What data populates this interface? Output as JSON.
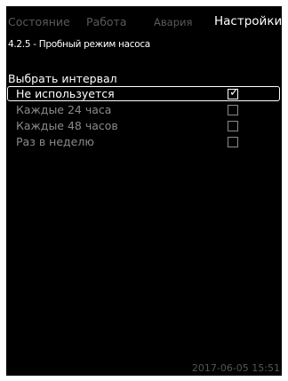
{
  "tabs": [
    {
      "label": "Состояние",
      "active": false
    },
    {
      "label": "Работа",
      "active": false
    },
    {
      "label": "Авария",
      "active": false
    },
    {
      "label": "Настройки",
      "active": true
    }
  ],
  "page_title": "4.2.5 - Пробный режим насоса",
  "section_label": "Выбрать интервал",
  "options": [
    {
      "label": "Не используется",
      "checked": true,
      "selected": true
    },
    {
      "label": "Каждые 24 часа",
      "checked": false,
      "selected": false
    },
    {
      "label": "Каждые 48 часов",
      "checked": false,
      "selected": false
    },
    {
      "label": "Раз в неделю",
      "checked": false,
      "selected": false
    }
  ],
  "check_symbol": "✓",
  "timestamp": "2017-06-05 15:51",
  "colors": {
    "background": "#000000",
    "active_text": "#ffffff",
    "inactive_tab": "#5a5a5a",
    "option_text": "#8a8a8a"
  }
}
